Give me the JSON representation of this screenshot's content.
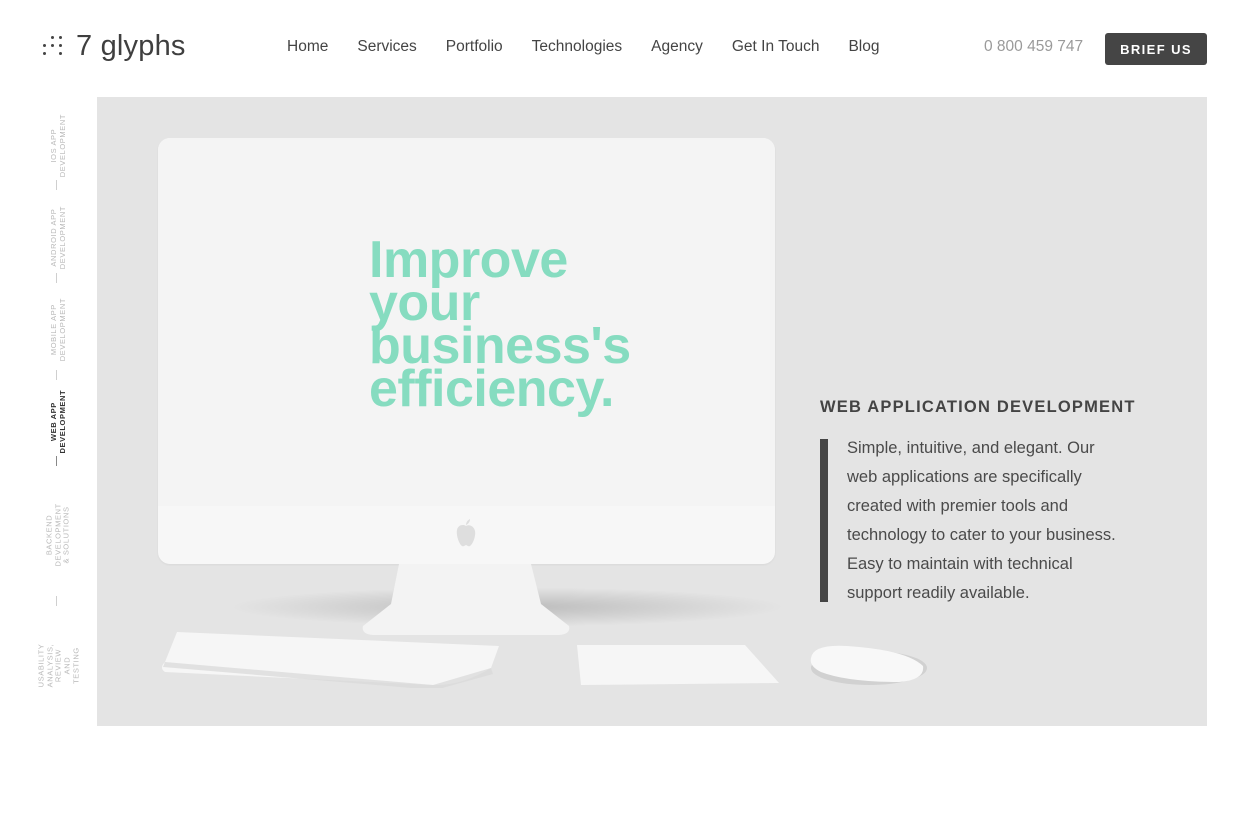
{
  "brand": {
    "name": "7 glyphs",
    "logo_icon": "dots-logo-icon"
  },
  "nav": {
    "items": [
      {
        "label": "Home"
      },
      {
        "label": "Services"
      },
      {
        "label": "Portfolio"
      },
      {
        "label": "Technologies"
      },
      {
        "label": "Agency"
      },
      {
        "label": "Get In Touch"
      },
      {
        "label": "Blog"
      }
    ]
  },
  "header": {
    "phone": "0 800 459 747",
    "cta_label": "BRIEF US"
  },
  "sidenav": {
    "items": [
      {
        "label": "iOS App Development"
      },
      {
        "label": "Android App Development"
      },
      {
        "label": "Mobile App Development"
      },
      {
        "label": "Web App Development",
        "active": true
      },
      {
        "label": "Backend Development & Solutions"
      },
      {
        "label": "Usability Analysis, Review and Testing"
      }
    ]
  },
  "hero": {
    "headline_lines": [
      "Improve",
      "your",
      "business's",
      "efficiency."
    ],
    "service_title": "WEB APPLICATION DEVELOPMENT",
    "service_desc_lines": [
      "Simple, intuitive, and elegant. Our",
      "web applications are specifically",
      "created with premier tools and",
      "technology to cater to your business.",
      "Easy to maintain with technical",
      "support readily available."
    ]
  },
  "colors": {
    "accent": "#86dcc0",
    "button": "#454545",
    "panel": "#e4e4e4"
  }
}
